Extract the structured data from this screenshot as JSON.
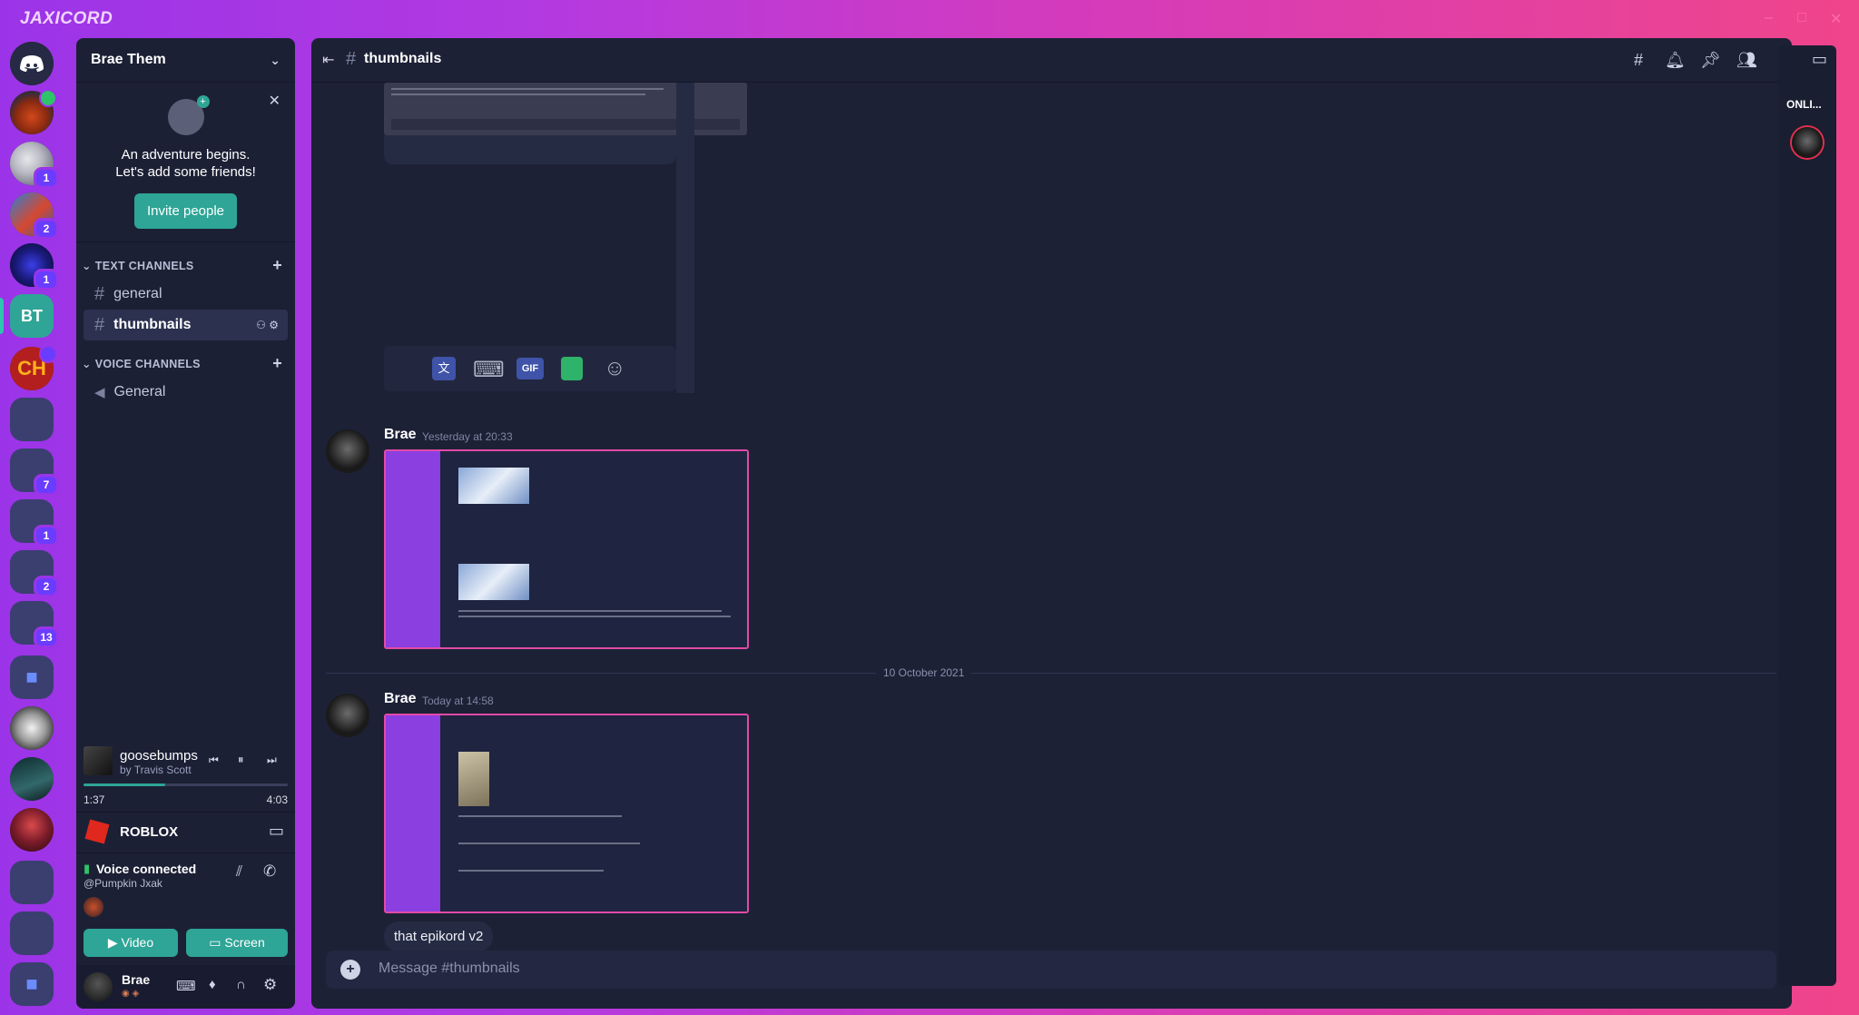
{
  "app": {
    "brand": "JAXICORD"
  },
  "window_controls": [
    "–",
    "□",
    "✕"
  ],
  "servers": [
    {
      "badge": ""
    },
    {
      "badge": "1"
    },
    {
      "badge": "2"
    },
    {
      "badge": "1"
    },
    {
      "initials": "BT",
      "badge": ""
    },
    {
      "badge": ""
    },
    {
      "badge": ""
    },
    {
      "badge": "7"
    },
    {
      "badge": "1"
    },
    {
      "badge": "2"
    },
    {
      "badge": "13"
    }
  ],
  "sidebar": {
    "server_name": "Brae Them",
    "welcome_line1": "An adventure begins.",
    "welcome_line2": "Let's add some friends!",
    "invite_label": "Invite people",
    "text_category": "TEXT CHANNELS",
    "voice_category": "VOICE CHANNELS",
    "text_channels": [
      {
        "name": "general"
      },
      {
        "name": "thumbnails"
      }
    ],
    "voice_channels": [
      {
        "name": "General"
      }
    ]
  },
  "now_playing": {
    "title": "goosebumps",
    "artist": "by Travis Scott",
    "elapsed": "1:37",
    "duration": "4:03",
    "progress_fraction": 0.4
  },
  "activity": {
    "game": "ROBLOX"
  },
  "voice": {
    "status": "Voice connected",
    "channel": "@Pumpkin Jxak",
    "video_label": "Video",
    "screen_label": "Screen"
  },
  "user": {
    "name": "Brae"
  },
  "channel_header": {
    "name": "thumbnails"
  },
  "messages": [
    {
      "author": "Brae",
      "timestamp": "Yesterday at 20:33"
    },
    {
      "author": "Brae",
      "timestamp": "Today at 14:58",
      "text": "that epikord v2"
    }
  ],
  "date_divider": "10 October 2021",
  "composer": {
    "placeholder": "Message #thumbnails"
  },
  "members": {
    "header": "ONLI..."
  },
  "colors": {
    "accent": "#2ea596",
    "frame": "#e24aa7",
    "background": "#1d2136"
  }
}
